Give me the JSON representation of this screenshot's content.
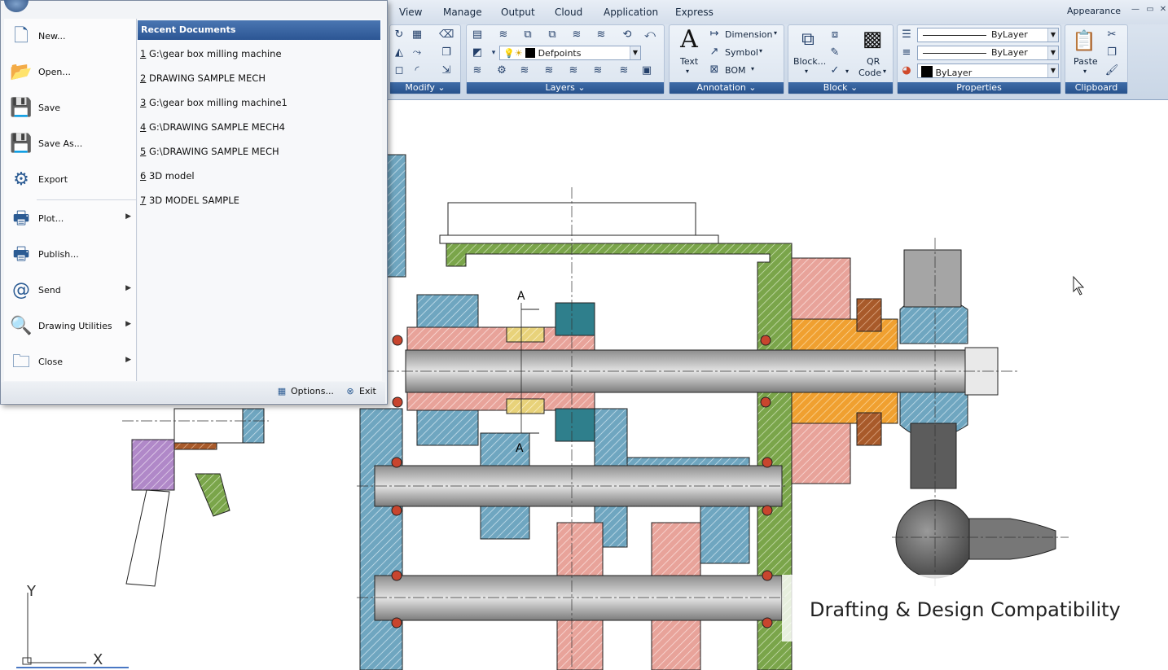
{
  "ribbon": {
    "tabs": [
      "View",
      "Manage",
      "Output",
      "Cloud",
      "Application",
      "Express"
    ],
    "appearance": "Appearance",
    "panels": {
      "modify": "Modify",
      "layers": "Layers",
      "annotation": "Annotation",
      "block": "Block",
      "properties": "Properties",
      "clipboard": "Clipboard"
    },
    "layer_combo": "Defpoints",
    "annotation": {
      "text": "Text",
      "dimension": "Dimension",
      "symbol": "Symbol",
      "bom": "BOM"
    },
    "block": {
      "block": "Block...",
      "qr_line1": "QR",
      "qr_line2": "Code"
    },
    "properties": {
      "linetype": "ByLayer",
      "lineweight": "ByLayer",
      "color": "ByLayer"
    },
    "clipboard": {
      "paste": "Paste"
    }
  },
  "app_menu": {
    "commands": [
      {
        "label": "New...",
        "icon": "new-document-icon",
        "submenu": false
      },
      {
        "label": "Open...",
        "icon": "open-folder-icon",
        "submenu": false
      },
      {
        "label": "Save",
        "icon": "save-icon",
        "submenu": false
      },
      {
        "label": "Save As...",
        "icon": "save-as-icon",
        "submenu": false
      },
      {
        "label": "Export",
        "icon": "export-icon",
        "submenu": false
      },
      {
        "label": "Plot...",
        "icon": "plot-printer-icon",
        "submenu": true
      },
      {
        "label": "Publish...",
        "icon": "publish-icon",
        "submenu": false
      },
      {
        "label": "Send",
        "icon": "at-sign-icon",
        "submenu": true
      },
      {
        "label": "Drawing Utilities",
        "icon": "drawing-utilities-icon",
        "submenu": true
      },
      {
        "label": "Close",
        "icon": "close-folder-icon",
        "submenu": true
      }
    ],
    "recent_header": "Recent Documents",
    "recent": [
      {
        "num": "1",
        "name": " G:\\gear box milling machine"
      },
      {
        "num": "2",
        "name": " DRAWING SAMPLE MECH"
      },
      {
        "num": "3",
        "name": " G:\\gear box milling machine1"
      },
      {
        "num": "4",
        "name": " G:\\DRAWING SAMPLE MECH4"
      },
      {
        "num": "5",
        "name": " G:\\DRAWING SAMPLE MECH"
      },
      {
        "num": "6",
        "name": " 3D model"
      },
      {
        "num": "7",
        "name": " 3D MODEL SAMPLE"
      }
    ],
    "options": "Options...",
    "exit": "Exit"
  },
  "drawing": {
    "section_label_top": "A",
    "section_label_bottom": "A",
    "ucs_y": "Y",
    "ucs_x": "X"
  },
  "caption": "Drafting & Design Compatibility",
  "colors": {
    "ribbon_title": "#27528c",
    "hatch_green": "#7aa54a",
    "hatch_blue": "#6fa6c0",
    "hatch_red": "#e8a39a",
    "hatch_orange": "#f0a030",
    "hatch_purple": "#b088c8",
    "hatch_yellow": "#e8d27a"
  }
}
